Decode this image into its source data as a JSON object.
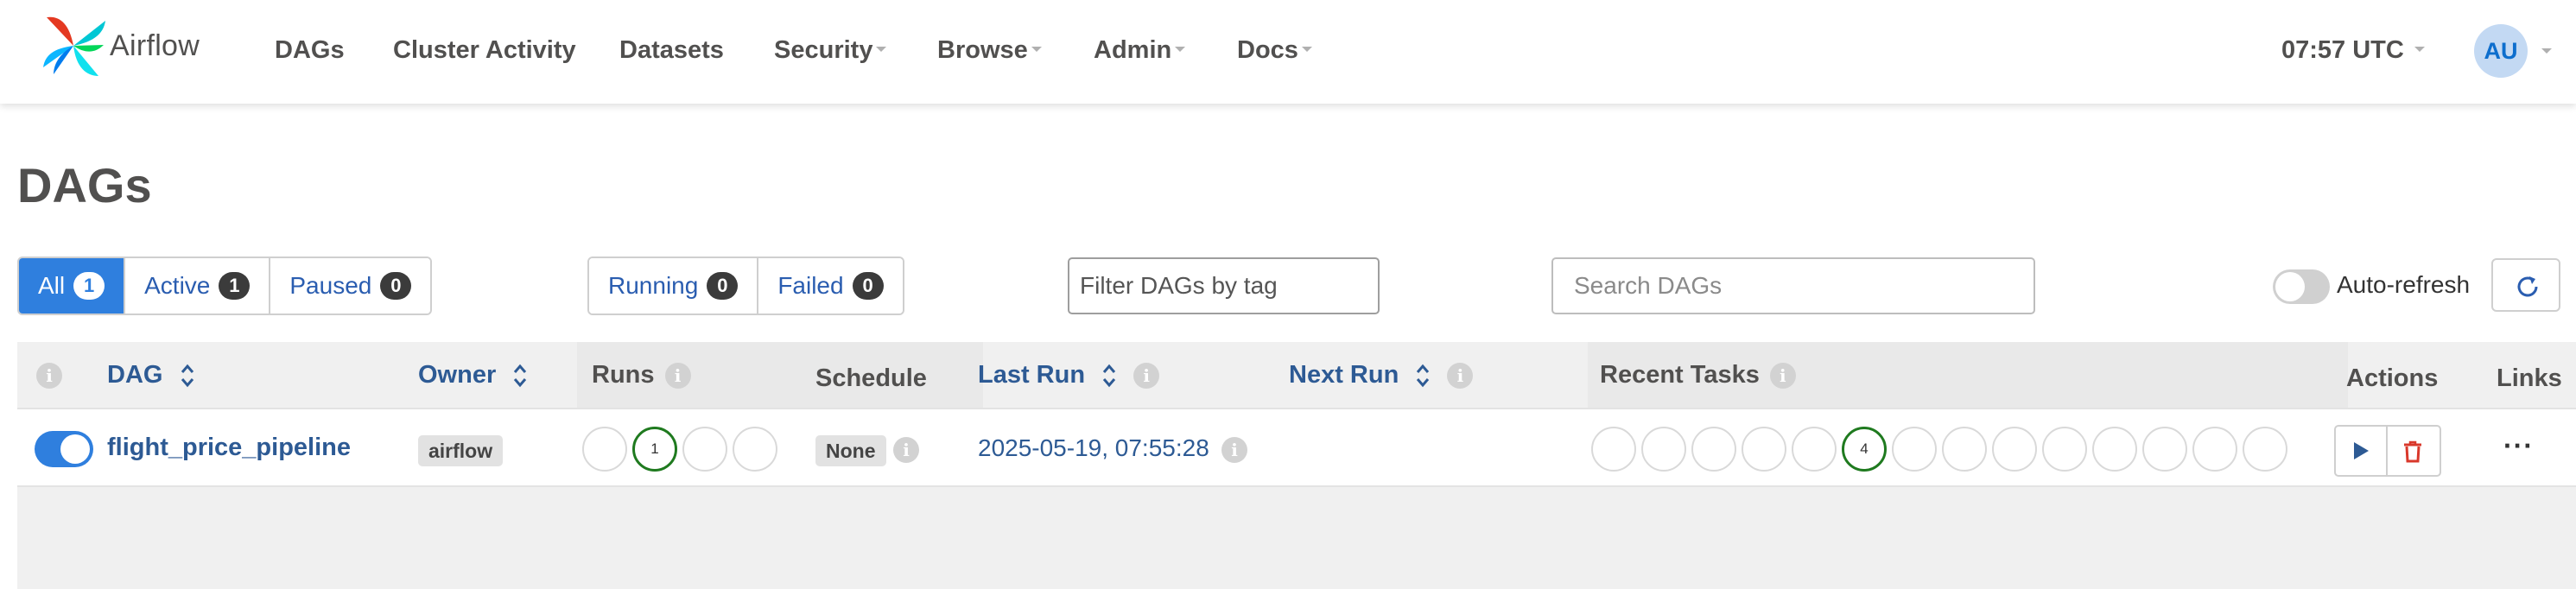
{
  "brand": {
    "name": "Airflow"
  },
  "nav": {
    "items": [
      {
        "label": "DAGs",
        "dropdown": false
      },
      {
        "label": "Cluster Activity",
        "dropdown": false
      },
      {
        "label": "Datasets",
        "dropdown": false
      },
      {
        "label": "Security",
        "dropdown": true
      },
      {
        "label": "Browse",
        "dropdown": true
      },
      {
        "label": "Admin",
        "dropdown": true
      },
      {
        "label": "Docs",
        "dropdown": true
      }
    ],
    "clock": "07:57 UTC",
    "user_initials": "AU"
  },
  "page": {
    "title": "DAGs"
  },
  "filters": {
    "status": [
      {
        "label": "All",
        "count": "1",
        "active": true
      },
      {
        "label": "Active",
        "count": "1",
        "active": false
      },
      {
        "label": "Paused",
        "count": "0",
        "active": false
      }
    ],
    "run_state": [
      {
        "label": "Running",
        "count": "0"
      },
      {
        "label": "Failed",
        "count": "0"
      }
    ],
    "tag_placeholder": "Filter DAGs by tag",
    "search_placeholder": "Search DAGs",
    "auto_refresh_label": "Auto-refresh",
    "auto_refresh_on": false
  },
  "table": {
    "headers": {
      "dag": "DAG",
      "owner": "Owner",
      "runs": "Runs",
      "schedule": "Schedule",
      "last_run": "Last Run",
      "next_run": "Next Run",
      "recent_tasks": "Recent Tasks",
      "actions": "Actions",
      "links": "Links"
    },
    "rows": [
      {
        "enabled": true,
        "dag_id": "flight_price_pipeline",
        "owner": "airflow",
        "runs": [
          "",
          "1",
          "",
          ""
        ],
        "schedule": "None",
        "last_run": "2025-05-19, 07:55:28",
        "next_run": "",
        "recent_tasks": [
          "",
          "",
          "",
          "",
          "",
          "4",
          "",
          "",
          "",
          "",
          "",
          "",
          "",
          ""
        ],
        "more_label": "···"
      }
    ]
  },
  "colors": {
    "primary": "#2f7fde",
    "link": "#2d5a94",
    "success": "#1f7a1f",
    "danger": "#d9382b"
  }
}
